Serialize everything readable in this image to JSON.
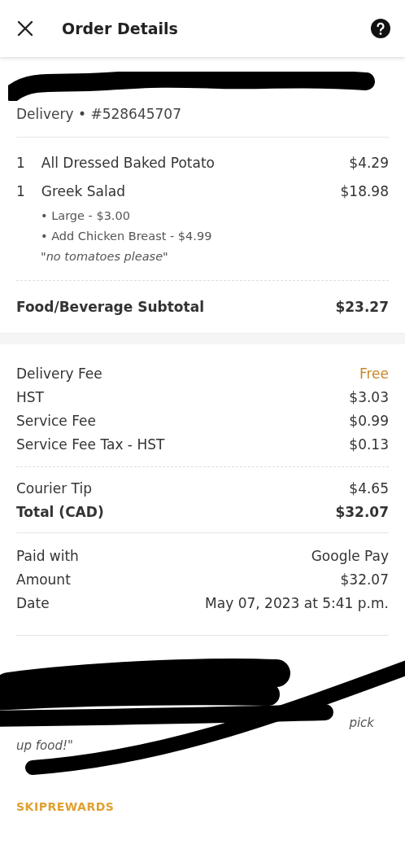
{
  "header": {
    "title": "Order Details"
  },
  "order": {
    "redacted": true,
    "type_line": "Delivery • #528645707"
  },
  "items": [
    {
      "qty": "1",
      "name": "All Dressed Baked Potato",
      "price": "$4.29"
    },
    {
      "qty": "1",
      "name": "Greek Salad",
      "price": "$18.98",
      "options": [
        "• Large - $3.00",
        "• Add Chicken Breast - $4.99"
      ],
      "note": "\"no tomatoes please\""
    }
  ],
  "subtotal": {
    "label": "Food/Beverage Subtotal",
    "value": "$23.27"
  },
  "fees": [
    {
      "label": "Delivery Fee",
      "value": "Free",
      "kind": "free"
    },
    {
      "label": "HST",
      "value": "$3.03",
      "kind": "amount"
    },
    {
      "label": "Service Fee",
      "value": "$0.99",
      "kind": "amount"
    },
    {
      "label": "Service Fee Tax - HST",
      "value": "$0.13",
      "kind": "amount"
    }
  ],
  "totals": [
    {
      "label": "Courier Tip",
      "value": "$4.65",
      "bold": false
    },
    {
      "label": "Total (CAD)",
      "value": "$32.07",
      "bold": true
    }
  ],
  "payment": [
    {
      "label": "Paid with",
      "value": "Google Pay"
    },
    {
      "label": "Amount",
      "value": "$32.07"
    },
    {
      "label": "Date",
      "value": "May 07, 2023 at 5:41 p.m."
    }
  ],
  "instructions": {
    "redacted": true,
    "fragment_end": "pick",
    "fragment_next": "up food!\""
  },
  "rewards": {
    "title": "SKIPREWARDS"
  }
}
